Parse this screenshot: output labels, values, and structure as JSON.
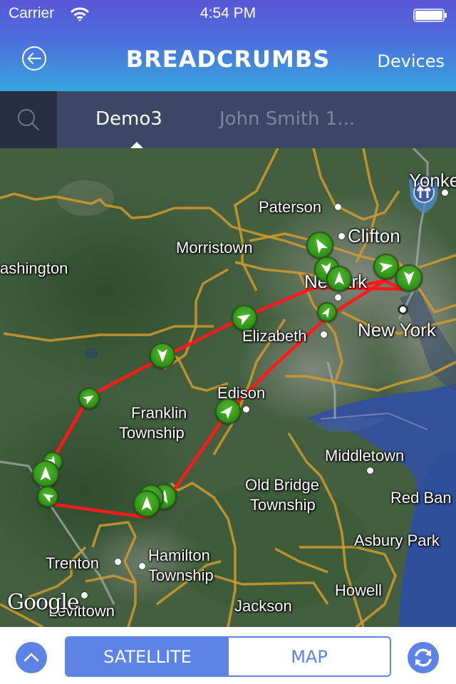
{
  "status_bar": {
    "carrier": "Carrier",
    "time": "4:54 PM",
    "battery_level": 1.0
  },
  "nav": {
    "title": "BREADCRUMBS",
    "back_icon": "circle-arrow-left-icon",
    "right_button": "Devices"
  },
  "tabs": {
    "search_icon": "search-icon",
    "items": [
      {
        "label": "Demo3",
        "active": true
      },
      {
        "label": "John Smith 1...",
        "active": false
      }
    ]
  },
  "map": {
    "type": "satellite",
    "attribution": "Google",
    "route_color": "#ff1a1a",
    "road_color": "#d19a2e",
    "marker_color": "#3ca11f",
    "places": [
      {
        "name": "Paterson"
      },
      {
        "name": "Clifton"
      },
      {
        "name": "Yonkers (partial: Yonke)"
      },
      {
        "name": "Morristown"
      },
      {
        "name": "Washington (partial: ashington)"
      },
      {
        "name": "Newark"
      },
      {
        "name": "New York"
      },
      {
        "name": "Elizabeth"
      },
      {
        "name": "Edison"
      },
      {
        "name": "Franklin Township"
      },
      {
        "name": "Middletown"
      },
      {
        "name": "Old Bridge Township"
      },
      {
        "name": "Red Bank (partial: Red Ban)"
      },
      {
        "name": "Asbury Park"
      },
      {
        "name": "Trenton"
      },
      {
        "name": "Hamilton Township"
      },
      {
        "name": "Howell"
      },
      {
        "name": "Jackson"
      },
      {
        "name": "Levittown"
      }
    ],
    "labels": {
      "paterson": "Paterson",
      "clifton": "Clifton",
      "yonkers": "Yonke",
      "morristown": "Morristown",
      "washington": "ashington",
      "newark": "Newark",
      "new_york": "New York",
      "elizabeth": "Elizabeth",
      "edison": "Edison",
      "franklin_1": "Franklin",
      "franklin_2": "Township",
      "middletown": "Middletown",
      "old_bridge_1": "Old Bridge",
      "old_bridge_2": "Township",
      "red_bank": "Red Ban",
      "asbury_park": "Asbury Park",
      "trenton": "Trenton",
      "hamilton_1": "Hamilton",
      "hamilton_2": "Township",
      "howell": "Howell",
      "jackson": "Jackson",
      "levittown": "Levittown",
      "google": "Google"
    },
    "breadcrumb_count": 17
  },
  "bottom_bar": {
    "up_icon": "chevron-up-icon",
    "segments": [
      {
        "label": "SATELLITE",
        "selected": true
      },
      {
        "label": "MAP",
        "selected": false
      }
    ],
    "refresh_icon": "refresh-icon"
  }
}
